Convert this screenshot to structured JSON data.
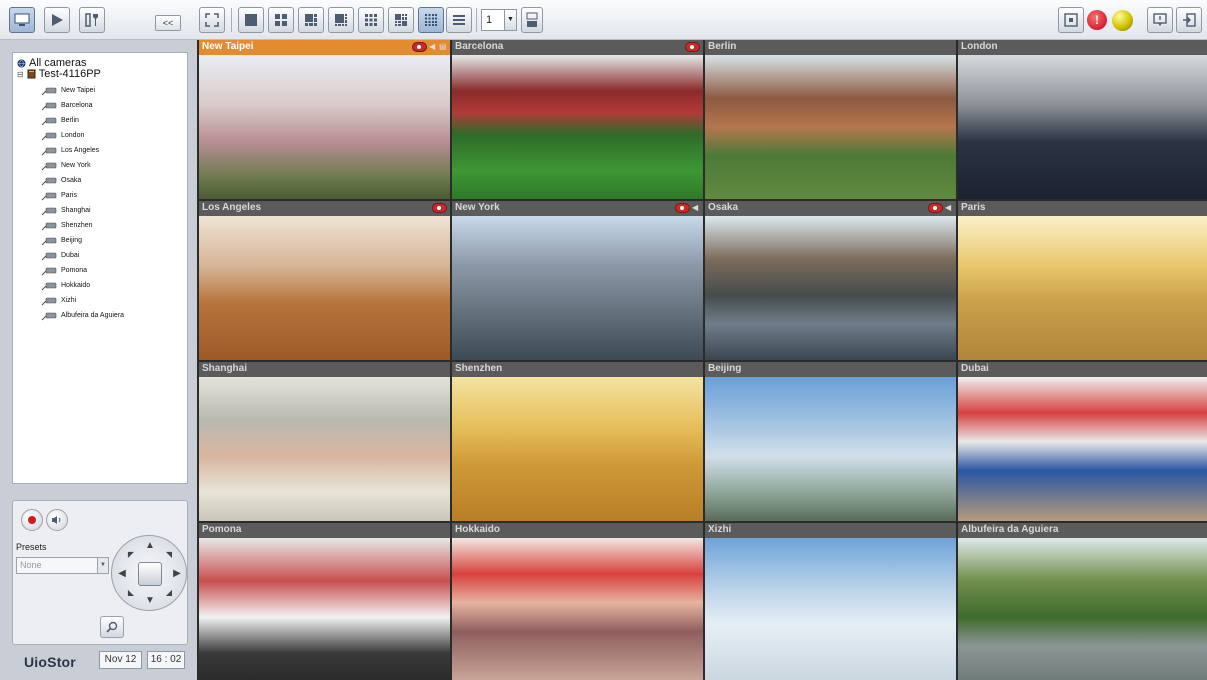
{
  "app": {
    "brand": "UioStor"
  },
  "toolbar": {
    "collapse_label": "<<",
    "page_number": "1"
  },
  "tree": {
    "root_label": "All cameras",
    "server_label": "Test-4116PP",
    "cameras": [
      "New Taipei",
      "Barcelona",
      "Berlin",
      "London",
      "Los Angeles",
      "New York",
      "Osaka",
      "Paris",
      "Shanghai",
      "Shenzhen",
      "Beijing",
      "Dubai",
      "Pomona",
      "Hokkaido",
      "Xizhi",
      "Albufeira da Aguiera"
    ]
  },
  "ptz": {
    "presets_label": "Presets",
    "presets_value": "None"
  },
  "status": {
    "date": "Nov 12",
    "time": "16 : 02"
  },
  "tiles": [
    {
      "name": "New Taipei",
      "selected": true
    },
    {
      "name": "Barcelona"
    },
    {
      "name": "Berlin"
    },
    {
      "name": "London"
    },
    {
      "name": "Los Angeles"
    },
    {
      "name": "New York"
    },
    {
      "name": "Osaka"
    },
    {
      "name": "Paris"
    },
    {
      "name": "Shanghai"
    },
    {
      "name": "Shenzhen"
    },
    {
      "name": "Beijing"
    },
    {
      "name": "Dubai"
    },
    {
      "name": "Pomona"
    },
    {
      "name": "Hokkaido"
    },
    {
      "name": "Xizhi"
    },
    {
      "name": "Albufeira da Aguiera"
    }
  ],
  "colors": {
    "selected_header": "#e48a2f",
    "tile_header": "#5b5b5b",
    "alarm": "#d0021b",
    "status_led": "#c9b400"
  }
}
